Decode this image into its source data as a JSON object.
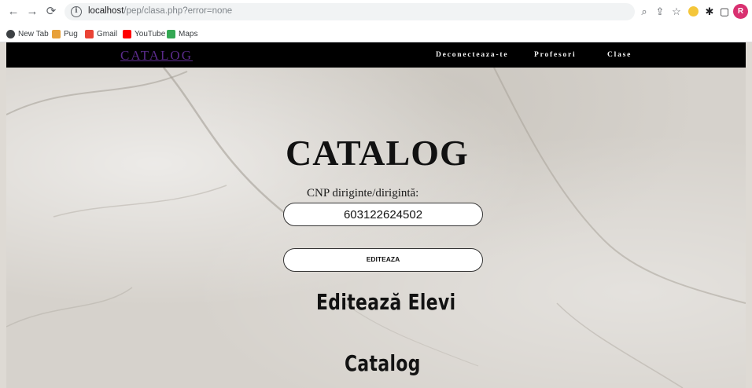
{
  "browser": {
    "url_host": "localhost",
    "url_path": "/pep/clasa.php?error=none",
    "bookmarks": [
      "New Tab",
      "Pug",
      "Gmail",
      "YouTube",
      "Maps"
    ],
    "profile_initial": "R"
  },
  "nav": {
    "logo": "CATALOG",
    "links": [
      "Deconecteaza-te",
      "Profesori",
      "Clase"
    ]
  },
  "page": {
    "title": "CATALOG",
    "cnp_label": "CNP diriginte/dirigintă:",
    "cnp_value": "603122624502",
    "edit_button": "EDITEAZA",
    "edit_students_link": "Editează Elevi",
    "catalog_link": "Catalog"
  },
  "colors": {
    "nav_bg": "#000000",
    "logo": "#5a2a8a",
    "page_bg": "#d6d2cc"
  }
}
